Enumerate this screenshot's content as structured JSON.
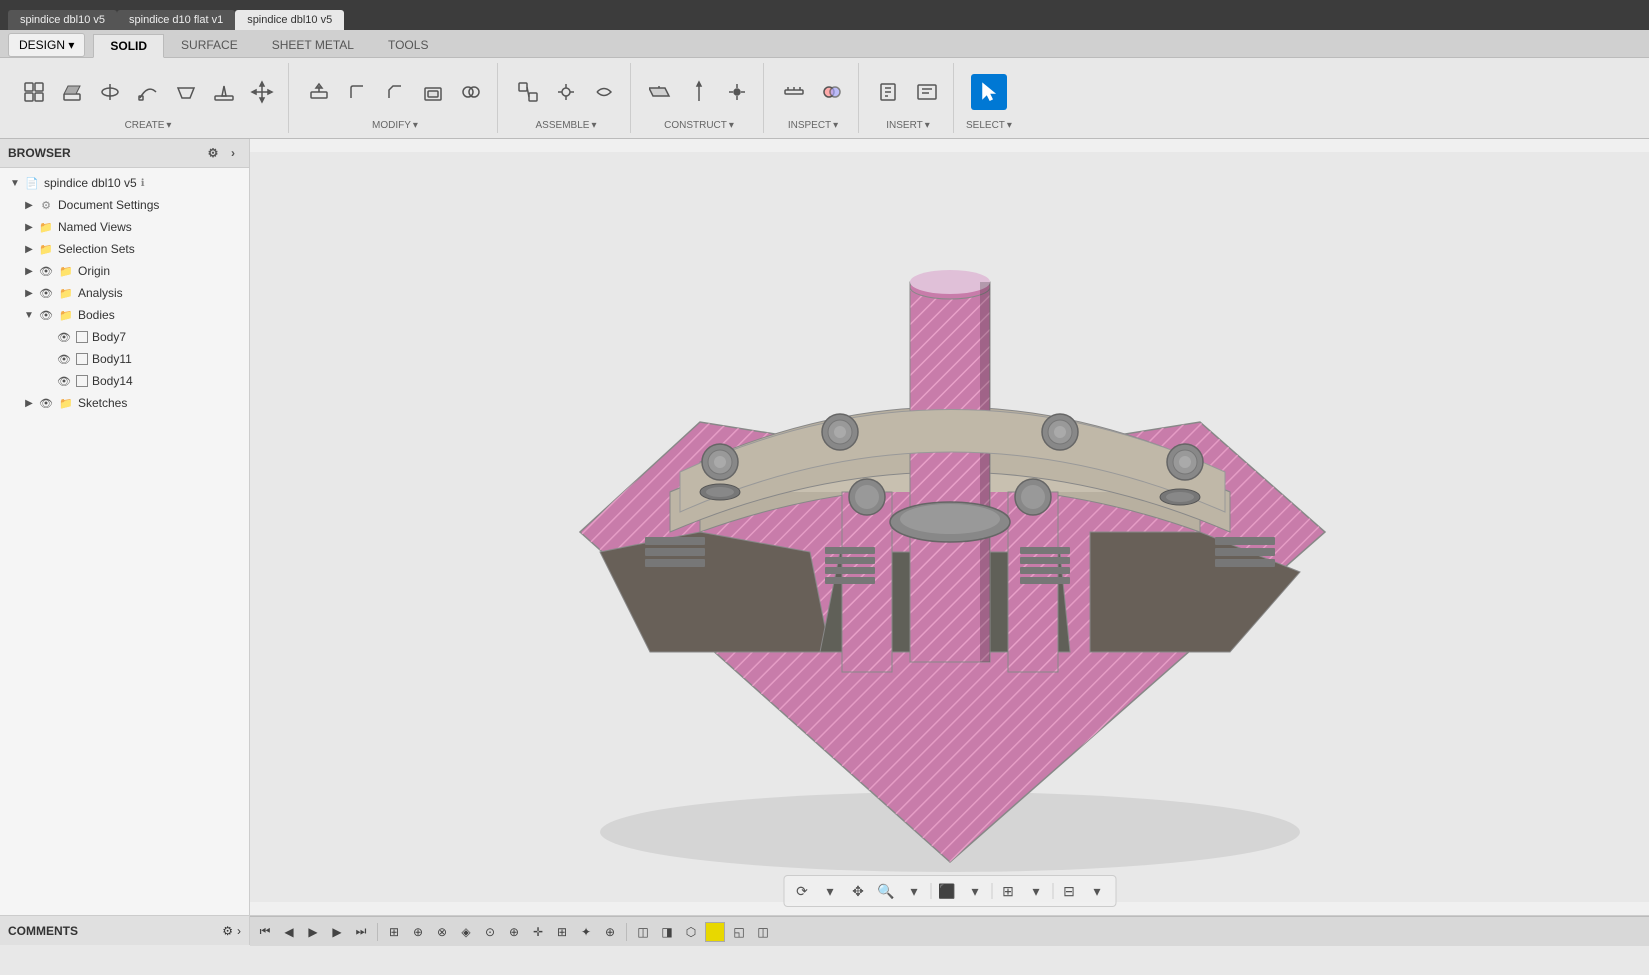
{
  "topBar": {
    "tabs": [
      {
        "label": "spindice dbl10 v5",
        "active": false
      },
      {
        "label": "spindice d10 flat v1",
        "active": false
      },
      {
        "label": "spindice dbl10 v5",
        "active": true
      }
    ]
  },
  "toolbar": {
    "designLabel": "DESIGN ▾",
    "tabs": [
      {
        "label": "SOLID",
        "active": true
      },
      {
        "label": "SURFACE",
        "active": false
      },
      {
        "label": "SHEET METAL",
        "active": false
      },
      {
        "label": "TOOLS",
        "active": false
      }
    ],
    "groups": [
      {
        "label": "CREATE",
        "icons": [
          "new-component",
          "extrude",
          "revolve",
          "sweep",
          "loft",
          "rib",
          "web",
          "emboss",
          "mirror",
          "pattern",
          "thicken"
        ]
      },
      {
        "label": "MODIFY",
        "icons": [
          "press-pull",
          "fillet",
          "chamfer",
          "shell",
          "scale",
          "combine",
          "split-body",
          "move"
        ]
      },
      {
        "label": "ASSEMBLE",
        "icons": [
          "new-component",
          "joint",
          "as-built",
          "motion",
          "drive",
          "motion-link"
        ]
      },
      {
        "label": "CONSTRUCT",
        "icons": [
          "offset-plane",
          "angle-plane",
          "tangent-plane",
          "midplane",
          "axis",
          "point"
        ]
      },
      {
        "label": "INSPECT",
        "icons": [
          "measure",
          "interference",
          "curvature",
          "accessibility",
          "draft",
          "zebra"
        ]
      },
      {
        "label": "INSERT",
        "icons": [
          "insert-derive",
          "canvas",
          "decal",
          "svg",
          "dxf",
          "mcad"
        ]
      },
      {
        "label": "SELECT",
        "icons": [
          "select-all"
        ]
      }
    ]
  },
  "browser": {
    "title": "BROWSER",
    "tree": [
      {
        "id": "root",
        "label": "spindice dbl10 v5",
        "type": "document",
        "level": 0,
        "expanded": true,
        "hasEye": false,
        "hasGear": true,
        "hasBadge": true
      },
      {
        "id": "doc-settings",
        "label": "Document Settings",
        "type": "settings",
        "level": 1,
        "expanded": false,
        "hasEye": false
      },
      {
        "id": "named-views",
        "label": "Named Views",
        "type": "folder",
        "level": 1,
        "expanded": false,
        "hasEye": false
      },
      {
        "id": "selection-sets",
        "label": "Selection Sets",
        "type": "folder",
        "level": 1,
        "expanded": false,
        "hasEye": false
      },
      {
        "id": "origin",
        "label": "Origin",
        "type": "folder",
        "level": 1,
        "expanded": false,
        "hasEye": true
      },
      {
        "id": "analysis",
        "label": "Analysis",
        "type": "folder",
        "level": 1,
        "expanded": false,
        "hasEye": true
      },
      {
        "id": "bodies",
        "label": "Bodies",
        "type": "folder",
        "level": 1,
        "expanded": true,
        "hasEye": true
      },
      {
        "id": "body7",
        "label": "Body7",
        "type": "body",
        "level": 2,
        "expanded": false,
        "hasEye": true,
        "hasCheck": true
      },
      {
        "id": "body11",
        "label": "Body11",
        "type": "body",
        "level": 2,
        "expanded": false,
        "hasEye": true,
        "hasCheck": true
      },
      {
        "id": "body14",
        "label": "Body14",
        "type": "body",
        "level": 2,
        "expanded": false,
        "hasEye": true,
        "hasCheck": true
      },
      {
        "id": "sketches",
        "label": "Sketches",
        "type": "folder",
        "level": 1,
        "expanded": false,
        "hasEye": true
      }
    ]
  },
  "comments": {
    "title": "COMMENTS"
  },
  "bottomToolbar": {
    "playback": [
      "⏮",
      "◀",
      "▶",
      "⏭",
      "⏭"
    ],
    "icons": []
  },
  "viewport": {
    "modelAlt": "3D CAD model of spindice dbl10 v5"
  }
}
